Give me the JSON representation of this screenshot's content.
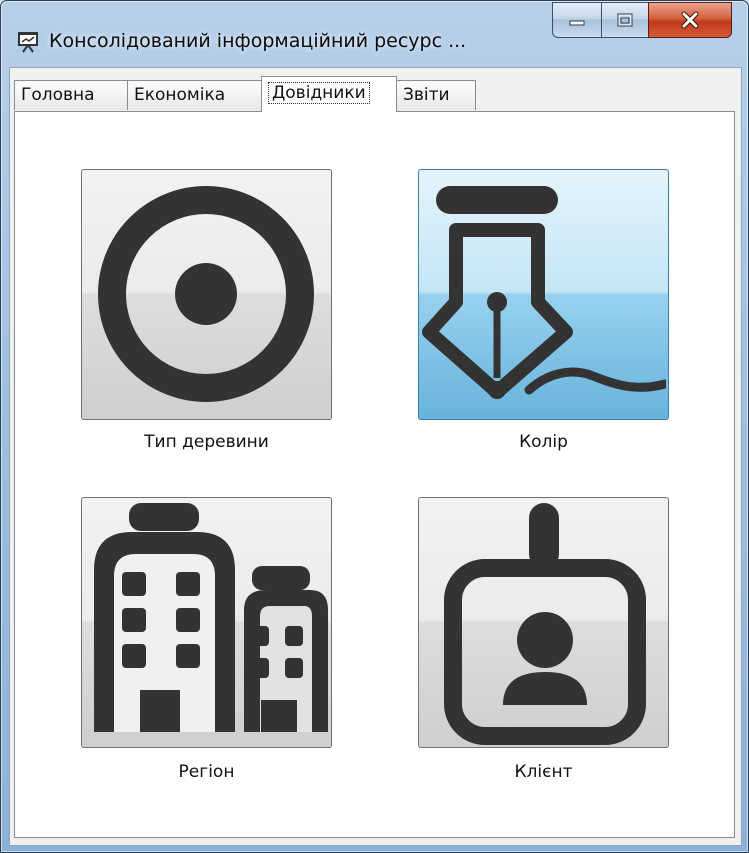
{
  "window": {
    "title": "Консолідований інформаційний ресурс ...",
    "controls": {
      "minimize": "minimize",
      "maximize": "maximize",
      "close": "close"
    }
  },
  "tabs": [
    {
      "label": "Головна",
      "active": false
    },
    {
      "label": "Економіка",
      "active": false
    },
    {
      "label": "Довідники",
      "active": true
    },
    {
      "label": "Звіти",
      "active": false
    }
  ],
  "tiles": [
    {
      "label": "Тип деревини",
      "icon": "target-icon",
      "selected": false
    },
    {
      "label": "Колір",
      "icon": "pen-nib-icon",
      "selected": true
    },
    {
      "label": "Регіон",
      "icon": "buildings-icon",
      "selected": false
    },
    {
      "label": "Клієнт",
      "icon": "id-badge-icon",
      "selected": false
    }
  ],
  "colors": {
    "icon": "#333333",
    "selected_tile": "#98d1ef",
    "close_button": "#c0391b"
  }
}
